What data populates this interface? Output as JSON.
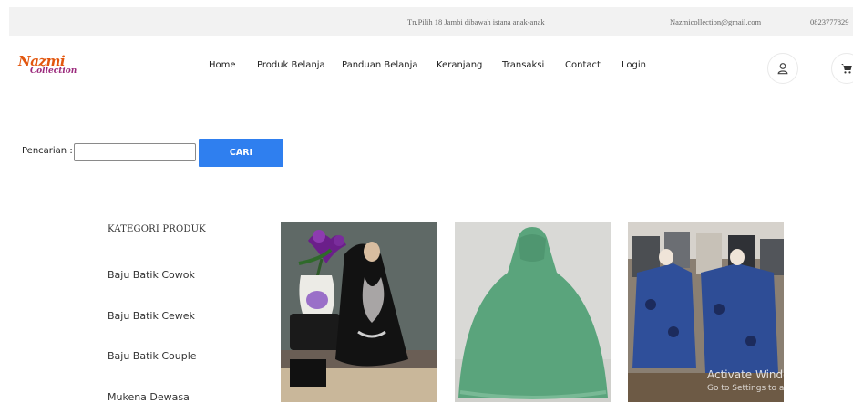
{
  "topbar": {
    "address": "Tn.Pilih 18 Jambi dibawah istana anak-anak",
    "email": "Nazmicollection@gmail.com",
    "phone": "0823777829"
  },
  "logo": {
    "line1": "Nazmi",
    "line2": "Collection"
  },
  "nav": {
    "items": [
      "Home",
      "Produk Belanja",
      "Panduan Belanja",
      "Keranjang",
      "Transaksi",
      "Contact",
      "Login"
    ],
    "user_icon": "user-icon",
    "cart_icon": "cart-icon"
  },
  "search": {
    "label": "Pencarian :",
    "value": "",
    "button": "CARI"
  },
  "categories": {
    "title": "KATEGORI PRODUK",
    "items": [
      "Baju Batik Cowok",
      "Baju Batik Cewek",
      "Baju Batik Couple",
      "Mukena Dewasa"
    ]
  },
  "watermark": {
    "line1": "Activate Windows",
    "line2": "Go to Settings to activate Windows"
  },
  "colors": {
    "accent": "#2f7fef",
    "logo_orange": "#e2570f",
    "logo_purple": "#9b2a7c"
  }
}
